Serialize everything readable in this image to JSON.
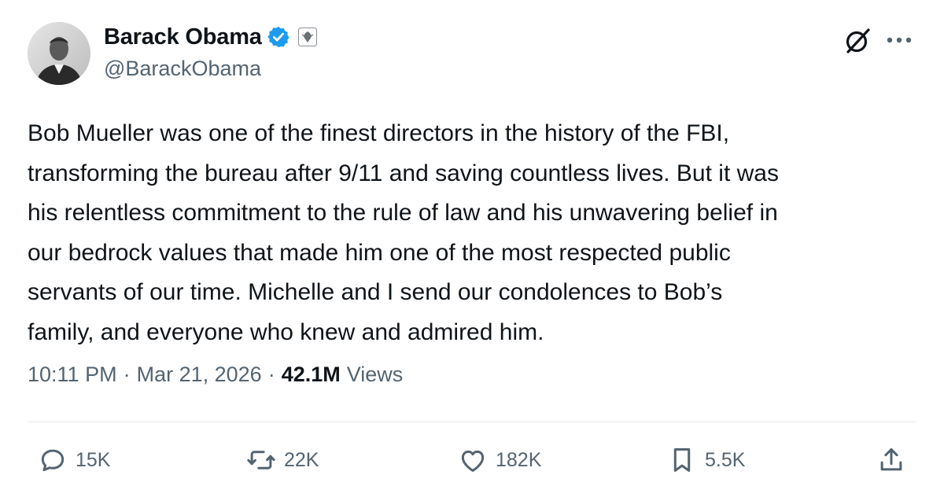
{
  "author": {
    "display_name": "Barack Obama",
    "handle": "@BarackObama",
    "verified_color": "#1d9bf0"
  },
  "tweet": {
    "text": "Bob Mueller was one of the finest directors in the history of the FBI,\ntransforming the bureau after 9/11 and saving countless lives. But it was\nhis relentless commitment to the rule of law and his unwavering belief in\nour bedrock values that made him one of the most respected public\nservants of our time. Michelle and I send our condolences to Bob’s\nfamily, and everyone who knew and admired him.",
    "time": "10:11 PM",
    "date": "Mar 21, 2026",
    "separator": "·",
    "views_count": "42.1M",
    "views_label": "Views"
  },
  "actions": {
    "replies": "15K",
    "reposts": "22K",
    "likes": "182K",
    "bookmarks": "5.5K"
  },
  "icons": {
    "avatar": "avatar-photo",
    "verified": "verified-badge-icon",
    "seal": "government-seal-icon",
    "grok": "grok-icon",
    "more": "more-icon",
    "reply": "reply-icon",
    "repost": "repost-icon",
    "like": "like-icon",
    "bookmark": "bookmark-icon",
    "share": "share-icon"
  }
}
